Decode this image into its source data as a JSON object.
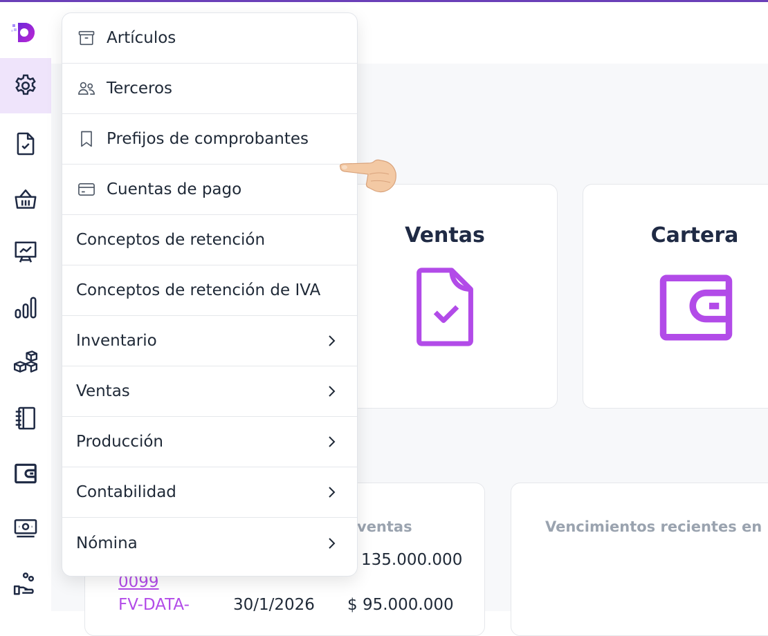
{
  "menu": {
    "items": [
      {
        "label": "Artículos",
        "icon": "archive-box-icon"
      },
      {
        "label": "Terceros",
        "icon": "users-icon"
      },
      {
        "label": "Prefijos de comprobantes",
        "icon": "bookmark-icon"
      },
      {
        "label": "Cuentas de pago",
        "icon": "credit-card-icon"
      },
      {
        "label": "Conceptos de retención"
      },
      {
        "label": "Conceptos de retención de IVA"
      },
      {
        "label": "Inventario",
        "submenu": true
      },
      {
        "label": "Ventas",
        "submenu": true
      },
      {
        "label": "Producción",
        "submenu": true
      },
      {
        "label": "Contabilidad",
        "submenu": true
      },
      {
        "label": "Nómina",
        "submenu": true
      }
    ]
  },
  "cards": {
    "ventas": {
      "title": "Ventas",
      "icon": "document-check-icon"
    },
    "cartera": {
      "title": "Cartera",
      "icon": "wallet-icon"
    }
  },
  "panels": {
    "ventas_title": "ventas",
    "vencimientos_title": "Vencimientos recientes en"
  },
  "rows": [
    {
      "amount": "135.000.000"
    },
    {
      "link": "0099"
    },
    {
      "link": "FV-DATA-",
      "date": "30/1/2026",
      "amount": "$ 95.000.000"
    }
  ],
  "colors": {
    "accent": "#b24be8",
    "topbar": "#6a3fb8",
    "sidebar_active": "#efe4fb",
    "sidebar_icon": "#1f2a44"
  },
  "sidebar": {
    "icons": [
      "logo-icon",
      "gear-icon",
      "document-check-icon",
      "basket-icon",
      "presentation-chart-icon",
      "bar-chart-icon",
      "cubes-icon",
      "notebook-icon",
      "wallet-icon",
      "banknote-icon",
      "hand-coins-icon"
    ]
  }
}
